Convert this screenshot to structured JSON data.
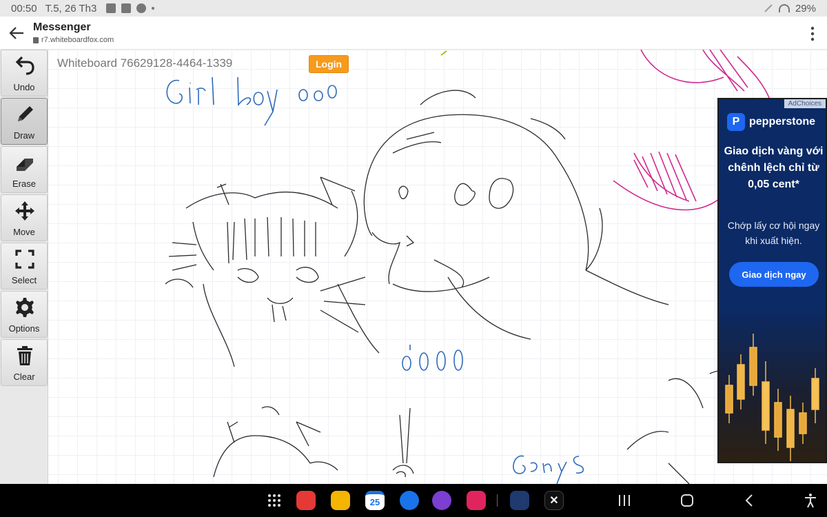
{
  "status_bar": {
    "time": "00:50",
    "date": "T.5, 26 Th3",
    "battery": "29%"
  },
  "header": {
    "title": "Messenger",
    "url": "r7.whiteboardfox.com"
  },
  "toolbar": {
    "tools": [
      {
        "label": "Undo",
        "icon": "undo-icon"
      },
      {
        "label": "Draw",
        "icon": "pencil-icon",
        "active": true
      },
      {
        "label": "Erase",
        "icon": "eraser-icon"
      },
      {
        "label": "Move",
        "icon": "move-arrows-icon"
      },
      {
        "label": "Select",
        "icon": "select-frame-icon"
      },
      {
        "label": "Options",
        "icon": "gear-icon"
      },
      {
        "label": "Clear",
        "icon": "trash-icon"
      }
    ]
  },
  "board": {
    "whiteboard_id": "Whiteboard 76629128-4464-1339",
    "login_label": "Login"
  },
  "ad": {
    "adchoices": "AdChoices",
    "brand": "pepperstone",
    "headline": "Giao dịch vàng với chênh lệch chỉ từ 0,05 cent*",
    "sub": "Chớp lấy cơ hội ngay khi xuất hiện.",
    "cta": "Giao dịch ngay",
    "colors": {
      "background": "#0b2a66",
      "button": "#1e67f0"
    }
  },
  "navbar": {
    "apps": [
      "apps-grid-icon",
      "flipboard-icon",
      "files-icon",
      "calendar-icon",
      "messages-icon",
      "internet-icon",
      "camera-icon",
      "ibis-paint-icon",
      "x-icon"
    ],
    "calendar_day": "25",
    "nav_buttons": [
      "recents-icon",
      "home-icon",
      "back-icon",
      "accessibility-icon"
    ]
  }
}
